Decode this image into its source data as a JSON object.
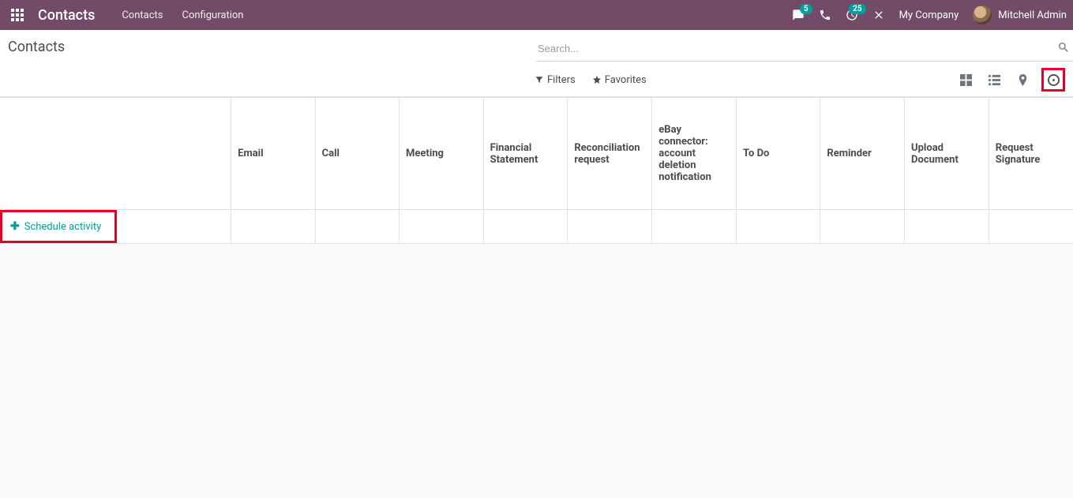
{
  "navbar": {
    "brand": "Contacts",
    "menu": [
      "Contacts",
      "Configuration"
    ],
    "badges": {
      "messages": "5",
      "activities": "25"
    },
    "company": "My Company",
    "user": "Mitchell Admin"
  },
  "control": {
    "breadcrumb": "Contacts",
    "search_placeholder": "Search...",
    "filters": {
      "filters_label": "Filters",
      "favorites_label": "Favorites"
    }
  },
  "table": {
    "columns": [
      "Email",
      "Call",
      "Meeting",
      "Financial Statement",
      "Reconciliation request",
      "eBay connector: account deletion notification",
      "To Do",
      "Reminder",
      "Upload Document",
      "Request Signature"
    ],
    "schedule_label": "Schedule activity"
  }
}
